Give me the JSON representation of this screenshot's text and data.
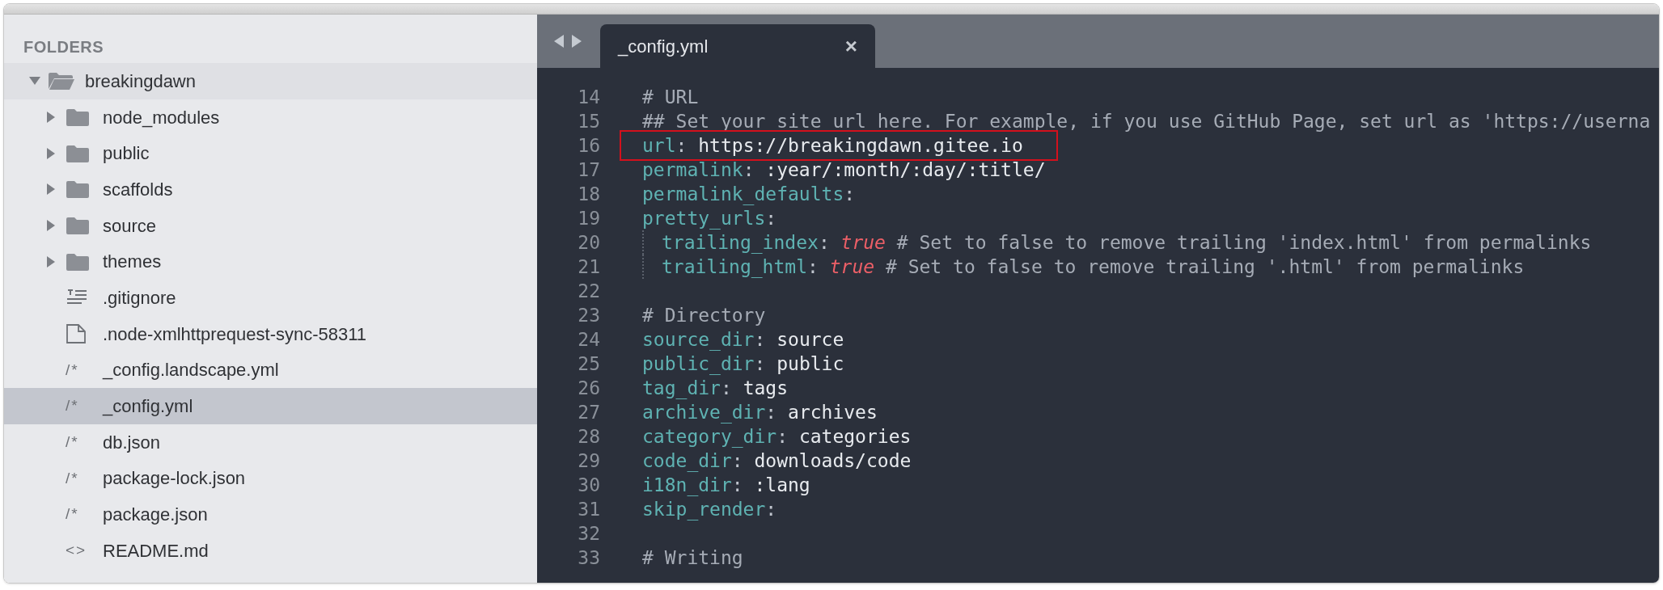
{
  "sidebar": {
    "heading": "FOLDERS",
    "tree": [
      {
        "name": "breakingdawn",
        "kind": "folder",
        "expanded": true,
        "selected": false,
        "children": [
          {
            "name": "node_modules",
            "kind": "folder",
            "expanded": false,
            "selected": false
          },
          {
            "name": "public",
            "kind": "folder",
            "expanded": false,
            "selected": false
          },
          {
            "name": "scaffolds",
            "kind": "folder",
            "expanded": false,
            "selected": false
          },
          {
            "name": "source",
            "kind": "folder",
            "expanded": false,
            "selected": false
          },
          {
            "name": "themes",
            "kind": "folder",
            "expanded": false,
            "selected": false
          },
          {
            "name": ".gitignore",
            "kind": "lines-file",
            "selected": false
          },
          {
            "name": ".node-xmlhttprequest-sync-58311",
            "kind": "blank-file",
            "selected": false
          },
          {
            "name": "_config.landscape.yml",
            "kind": "glyph-file",
            "glyph": "/*",
            "selected": false
          },
          {
            "name": "_config.yml",
            "kind": "glyph-file",
            "glyph": "/*",
            "selected": true
          },
          {
            "name": "db.json",
            "kind": "glyph-file",
            "glyph": "/*",
            "selected": false
          },
          {
            "name": "package-lock.json",
            "kind": "glyph-file",
            "glyph": "/*",
            "selected": false
          },
          {
            "name": "package.json",
            "kind": "glyph-file",
            "glyph": "/*",
            "selected": false
          },
          {
            "name": "README.md",
            "kind": "glyph-file",
            "glyph": "<>",
            "selected": false
          }
        ]
      }
    ]
  },
  "tabs": [
    {
      "label": "_config.yml",
      "close": "×",
      "selected": true
    }
  ],
  "editor": {
    "lines": [
      {
        "number": "14",
        "tokens": [
          {
            "kind": "comment",
            "text": "# URL"
          }
        ]
      },
      {
        "number": "15",
        "tokens": [
          {
            "kind": "comment",
            "text": "## Set your site url here. For example, if you use GitHub Page, set url as 'https://userna"
          }
        ]
      },
      {
        "number": "16",
        "highlighted": true,
        "tokens": [
          {
            "kind": "key",
            "text": "url"
          },
          {
            "kind": "punct",
            "text": ": "
          },
          {
            "kind": "value",
            "text": "https://breakingdawn.gitee.io"
          }
        ]
      },
      {
        "number": "17",
        "tokens": [
          {
            "kind": "key",
            "text": "permalink"
          },
          {
            "kind": "punct",
            "text": ": "
          },
          {
            "kind": "value",
            "text": ":year/:month/:day/:title/"
          }
        ]
      },
      {
        "number": "18",
        "tokens": [
          {
            "kind": "key",
            "text": "permalink_defaults"
          },
          {
            "kind": "punct",
            "text": ":"
          }
        ]
      },
      {
        "number": "19",
        "tokens": [
          {
            "kind": "key",
            "text": "pretty_urls"
          },
          {
            "kind": "punct",
            "text": ":"
          }
        ]
      },
      {
        "number": "20",
        "guide": true,
        "tokens": [
          {
            "kind": "key",
            "text": "trailing_index"
          },
          {
            "kind": "punct",
            "text": ": "
          },
          {
            "kind": "bool",
            "text": "true"
          },
          {
            "kind": "comment",
            "text": " # Set to false to remove trailing 'index.html' from permalinks"
          }
        ]
      },
      {
        "number": "21",
        "guide": true,
        "tokens": [
          {
            "kind": "key",
            "text": "trailing_html"
          },
          {
            "kind": "punct",
            "text": ": "
          },
          {
            "kind": "bool",
            "text": "true"
          },
          {
            "kind": "comment",
            "text": " # Set to false to remove trailing '.html' from permalinks"
          }
        ]
      },
      {
        "number": "22"
      },
      {
        "number": "23",
        "tokens": [
          {
            "kind": "comment",
            "text": "# Directory"
          }
        ]
      },
      {
        "number": "24",
        "tokens": [
          {
            "kind": "key",
            "text": "source_dir"
          },
          {
            "kind": "punct",
            "text": ": "
          },
          {
            "kind": "value",
            "text": "source"
          }
        ]
      },
      {
        "number": "25",
        "tokens": [
          {
            "kind": "key",
            "text": "public_dir"
          },
          {
            "kind": "punct",
            "text": ": "
          },
          {
            "kind": "value",
            "text": "public"
          }
        ]
      },
      {
        "number": "26",
        "tokens": [
          {
            "kind": "key",
            "text": "tag_dir"
          },
          {
            "kind": "punct",
            "text": ": "
          },
          {
            "kind": "value",
            "text": "tags"
          }
        ]
      },
      {
        "number": "27",
        "tokens": [
          {
            "kind": "key",
            "text": "archive_dir"
          },
          {
            "kind": "punct",
            "text": ": "
          },
          {
            "kind": "value",
            "text": "archives"
          }
        ]
      },
      {
        "number": "28",
        "tokens": [
          {
            "kind": "key",
            "text": "category_dir"
          },
          {
            "kind": "punct",
            "text": ": "
          },
          {
            "kind": "value",
            "text": "categories"
          }
        ]
      },
      {
        "number": "29",
        "tokens": [
          {
            "kind": "key",
            "text": "code_dir"
          },
          {
            "kind": "punct",
            "text": ": "
          },
          {
            "kind": "value",
            "text": "downloads/code"
          }
        ]
      },
      {
        "number": "30",
        "tokens": [
          {
            "kind": "key",
            "text": "i18n_dir"
          },
          {
            "kind": "punct",
            "text": ": "
          },
          {
            "kind": "value",
            "text": ":lang"
          }
        ]
      },
      {
        "number": "31",
        "tokens": [
          {
            "kind": "key",
            "text": "skip_render"
          },
          {
            "kind": "punct",
            "text": ":"
          }
        ]
      },
      {
        "number": "32"
      },
      {
        "number": "33",
        "tokens": [
          {
            "kind": "comment",
            "text": "# Writing"
          }
        ]
      }
    ]
  }
}
